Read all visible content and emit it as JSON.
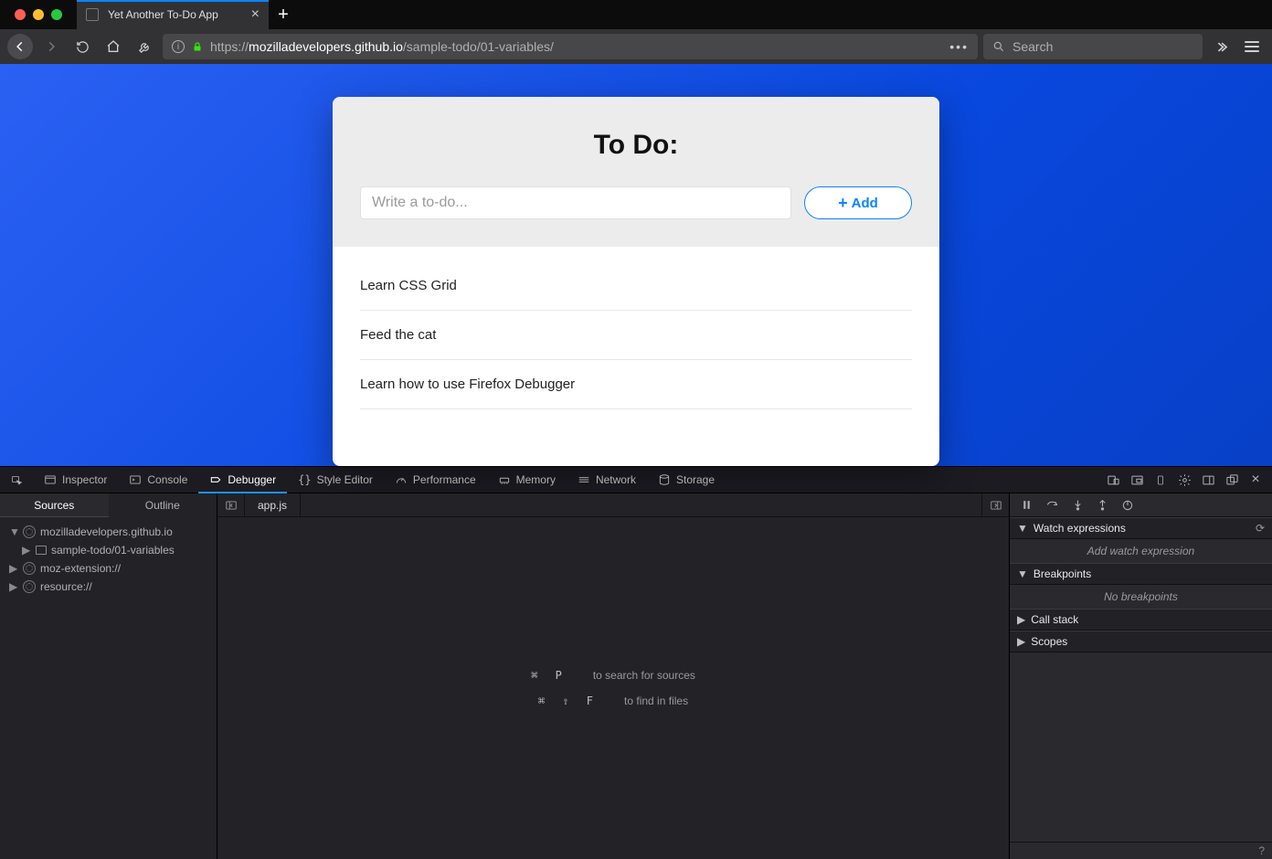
{
  "browser": {
    "tab_title": "Yet Another To-Do App",
    "url_host": "mozilladevelopers.github.io",
    "url_path": "/sample-todo/01-variables/",
    "url_scheme": "https://",
    "search_placeholder": "Search"
  },
  "page": {
    "title": "To Do:",
    "input_placeholder": "Write a to-do...",
    "add_label": "Add",
    "items": [
      "Learn CSS Grid",
      "Feed the cat",
      "Learn how to use Firefox Debugger"
    ]
  },
  "devtools": {
    "tabs": [
      "Inspector",
      "Console",
      "Debugger",
      "Style Editor",
      "Performance",
      "Memory",
      "Network",
      "Storage"
    ],
    "active_tab": "Debugger",
    "subtabs": {
      "sources": "Sources",
      "outline": "Outline"
    },
    "file_open": "app.js",
    "tree": {
      "root1": "mozilladevelopers.github.io",
      "root1_child": "sample-todo/01-variables",
      "root2": "moz-extension://",
      "root3": "resource://"
    },
    "hints": {
      "k1": "⌘  P",
      "t1": "to search for sources",
      "k2": "⌘  ⇧  F",
      "t2": "to find in files"
    },
    "right": {
      "watch_h": "Watch expressions",
      "watch_empty": "Add watch expression",
      "bp_h": "Breakpoints",
      "bp_empty": "No breakpoints",
      "cs_h": "Call stack",
      "sc_h": "Scopes"
    }
  }
}
